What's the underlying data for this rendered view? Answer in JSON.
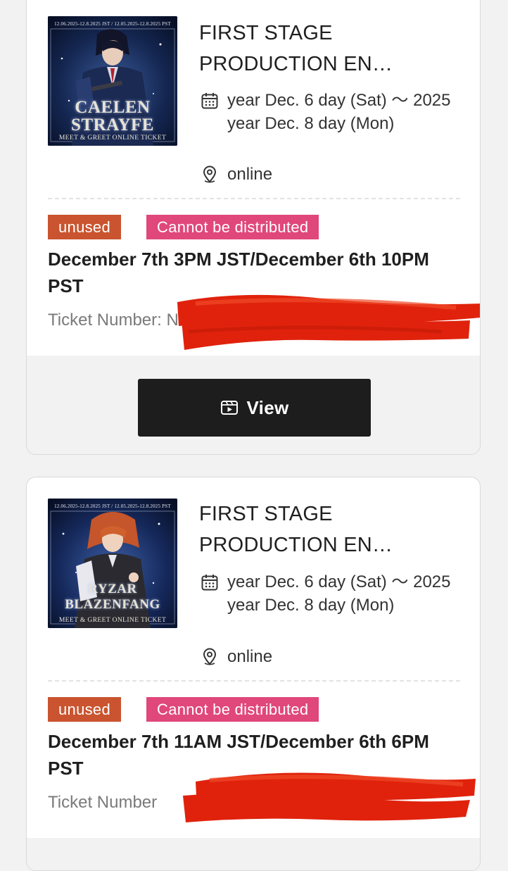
{
  "tickets": [
    {
      "title": "FIRST STAGE PRODUCTION EN…",
      "date": "year Dec. 6 day (Sat) ～ 2025 year Dec. 8 day (Mon)",
      "location": "online",
      "status_unused": "unused",
      "status_distribution": "Cannot be distributed",
      "slot": "December 7th 3PM JST/December 6th 10PM PST",
      "ticket_number_label": "Ticket Number",
      "ticket_number_partial": ": N",
      "thumb": {
        "date_band": "12.06.2025-12.8.2025 JST / 12.05.2025-12.8.2025 PST",
        "name_line1": "CAELEN",
        "name_line2": "STRAYFE",
        "tagline": "Meet & Greet Online Ticket"
      },
      "view_label": "View",
      "icons": {
        "date": "calendar-icon",
        "location": "map-pin-icon",
        "view": "ticket-view-icon"
      }
    },
    {
      "title": "FIRST STAGE PRODUCTION EN…",
      "date": "year Dec. 6 day (Sat) ～ 2025 year Dec. 8 day (Mon)",
      "location": "online",
      "status_unused": "unused",
      "status_distribution": "Cannot be distributed",
      "slot": "December 7th 11AM JST/December 6th 6PM PST",
      "ticket_number_label": "Ticket Number",
      "thumb": {
        "date_band": "12.06.2025-12.8.2025 JST / 12.05.2025-12.8.2025 PST",
        "name_line1": "RYZAR",
        "name_line2": "BLAZENFANG",
        "tagline": "Meet & Greet Online Ticket"
      },
      "icons": {
        "date": "calendar-icon",
        "location": "map-pin-icon"
      }
    }
  ],
  "colors": {
    "unused_badge": "#c9542f",
    "distribution_badge": "#e0477a",
    "view_button": "#1d1d1d",
    "redaction": "#e0220c"
  }
}
